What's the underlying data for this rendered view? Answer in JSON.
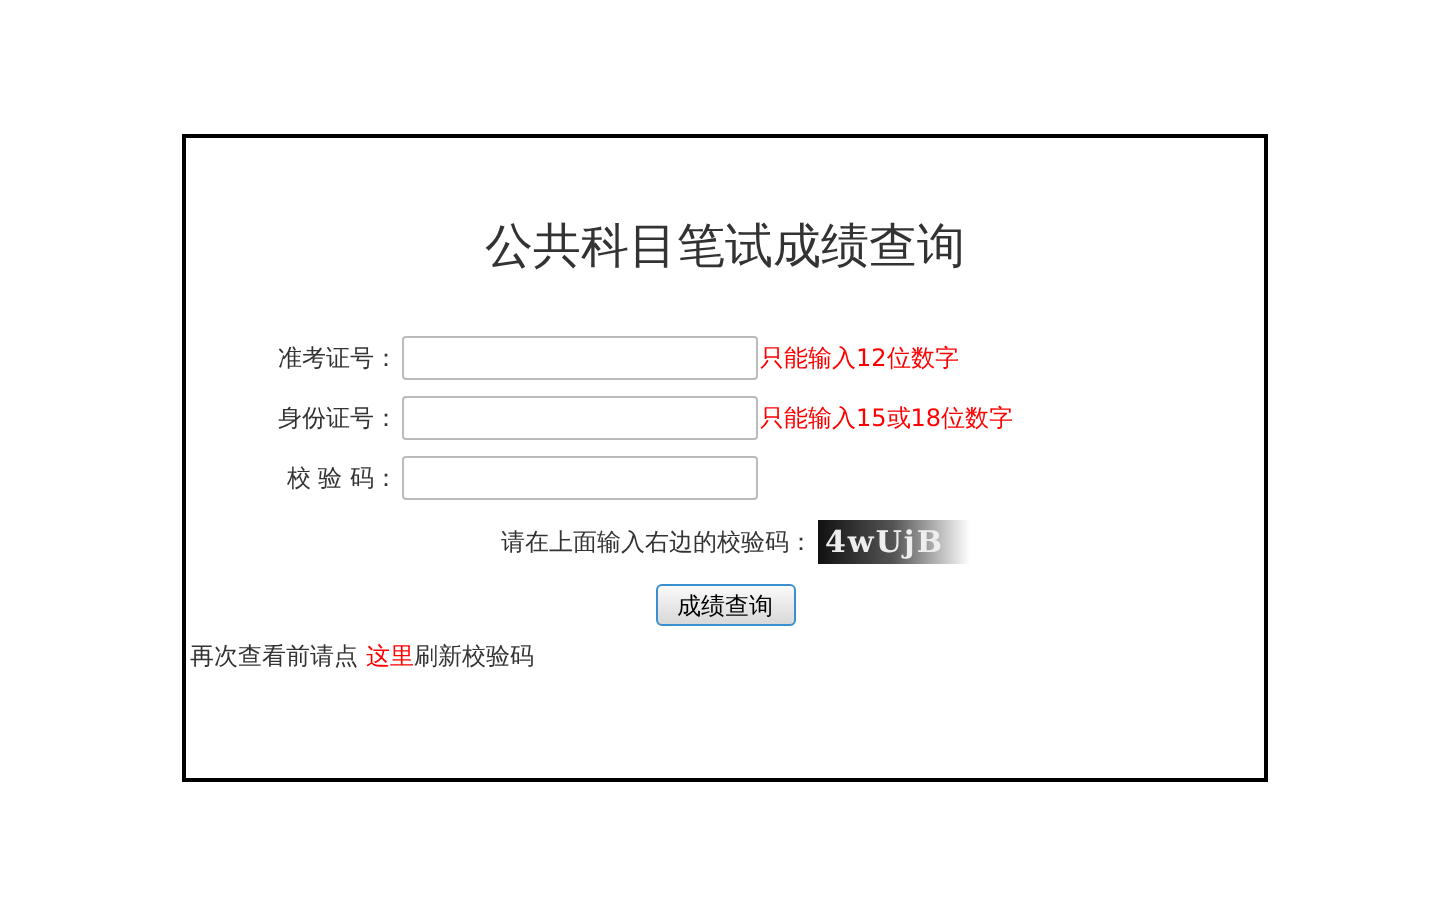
{
  "title": "公共科目笔试成绩查询",
  "fields": [
    {
      "label": "准考证号：",
      "hint": "只能输入12位数字"
    },
    {
      "label": "身份证号：",
      "hint": "只能输入15或18位数字"
    },
    {
      "label": "校 验 码："
    }
  ],
  "captcha": {
    "prompt": "请在上面输入右边的校验码：",
    "code": "4wUjB"
  },
  "submit": "成绩查询",
  "footer": {
    "before": "再次查看前请点 ",
    "link": "这里",
    "after": "刷新校验码"
  }
}
